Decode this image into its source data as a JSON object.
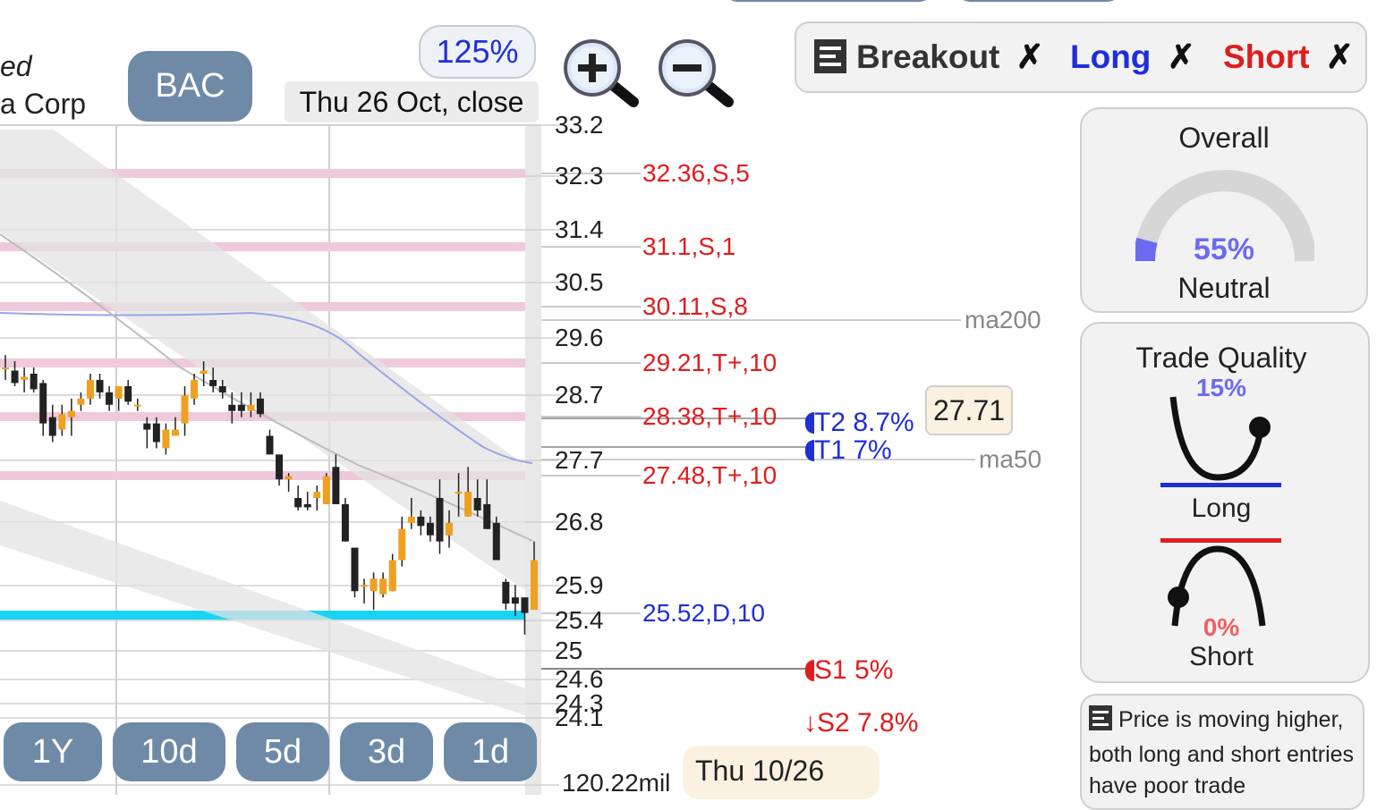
{
  "header": {
    "title_partial_1": "ed",
    "title_partial_2": "a Corp",
    "symbol": "BAC",
    "zoom_level": "125%",
    "date_label": "Thu 26 Oct, close"
  },
  "toggles": {
    "breakout": "Breakout",
    "long": "Long",
    "short": "Short",
    "off_mark": "✗"
  },
  "colors": {
    "long": "#1f2fd8",
    "short": "#e01d1d",
    "resistance_band": "#efc9dc",
    "support_line": "#19d3f5",
    "bullish_candle": "#f0a020",
    "bearish_candle": "#222222",
    "button": "#6f8aa6"
  },
  "price_axis": [
    "33.2",
    "32.3",
    "31.4",
    "30.5",
    "29.6",
    "28.7",
    "27.7",
    "26.8",
    "25.9",
    "25.4",
    "25",
    "24.6",
    "24.3",
    "24.1"
  ],
  "levels": [
    {
      "label": "32.36,S,5",
      "color": "red"
    },
    {
      "label": "31.1,S,1",
      "color": "red"
    },
    {
      "label": "30.11,S,8",
      "color": "red"
    },
    {
      "label": "29.21,T+,10",
      "color": "red"
    },
    {
      "label": "28.38,T+,10",
      "color": "red"
    },
    {
      "label": "27.48,T+,10",
      "color": "red"
    },
    {
      "label": "25.52,D,10",
      "color": "blue"
    }
  ],
  "moving_averages": {
    "ma200": "ma200",
    "ma50": "ma50"
  },
  "current_price": "27.71",
  "targets": {
    "t2": "T2 8.7%",
    "t1": "T1 7%",
    "s1": "S1 5%",
    "s2": "S2 7.8%"
  },
  "volume_label": "120.22mil",
  "cursor_date": "Thu 10/26",
  "timeframes": [
    "1Y",
    "10d",
    "5d",
    "3d",
    "1d"
  ],
  "overall": {
    "title": "Overall",
    "percent": "55%",
    "verdict": "Neutral",
    "value": 0.55
  },
  "trade_quality": {
    "title": "Trade Quality",
    "long_percent": "15%",
    "long_label": "Long",
    "short_percent": "0%",
    "short_label": "Short"
  },
  "note": {
    "text": "Price is moving higher, both long and short entries have poor trade"
  },
  "chart_data": {
    "type": "candlestick",
    "candles": [
      {
        "o": 29.3,
        "h": 29.5,
        "l": 29.1,
        "c": 29.3
      },
      {
        "o": 29.25,
        "h": 29.4,
        "l": 29.0,
        "c": 29.05
      },
      {
        "o": 29.1,
        "h": 29.3,
        "l": 28.9,
        "c": 29.15
      },
      {
        "o": 29.2,
        "h": 29.3,
        "l": 28.9,
        "c": 28.95
      },
      {
        "o": 29.05,
        "h": 29.1,
        "l": 28.2,
        "c": 28.4
      },
      {
        "o": 28.5,
        "h": 28.7,
        "l": 28.1,
        "c": 28.2
      },
      {
        "o": 28.3,
        "h": 28.7,
        "l": 28.2,
        "c": 28.55
      },
      {
        "o": 28.5,
        "h": 28.8,
        "l": 28.2,
        "c": 28.6
      },
      {
        "o": 28.7,
        "h": 28.9,
        "l": 28.6,
        "c": 28.8
      },
      {
        "o": 28.8,
        "h": 29.2,
        "l": 28.7,
        "c": 29.1
      },
      {
        "o": 29.1,
        "h": 29.2,
        "l": 28.8,
        "c": 28.9
      },
      {
        "o": 28.9,
        "h": 29.0,
        "l": 28.6,
        "c": 28.7
      },
      {
        "o": 28.8,
        "h": 29.0,
        "l": 28.6,
        "c": 29.0
      },
      {
        "o": 29.0,
        "h": 29.1,
        "l": 28.7,
        "c": 28.75
      },
      {
        "o": 28.7,
        "h": 28.8,
        "l": 28.6,
        "c": 28.7
      },
      {
        "o": 28.4,
        "h": 28.5,
        "l": 28.0,
        "c": 28.3
      },
      {
        "o": 28.4,
        "h": 28.5,
        "l": 28.0,
        "c": 28.1
      },
      {
        "o": 28.0,
        "h": 28.4,
        "l": 27.9,
        "c": 28.3
      },
      {
        "o": 28.2,
        "h": 28.5,
        "l": 28.2,
        "c": 28.3
      },
      {
        "o": 28.4,
        "h": 29.0,
        "l": 28.2,
        "c": 28.85
      },
      {
        "o": 28.8,
        "h": 29.2,
        "l": 28.7,
        "c": 29.1
      },
      {
        "o": 29.2,
        "h": 29.4,
        "l": 29.0,
        "c": 29.25
      },
      {
        "o": 29.1,
        "h": 29.3,
        "l": 28.9,
        "c": 29.0
      },
      {
        "o": 29.0,
        "h": 29.1,
        "l": 28.8,
        "c": 28.9
      },
      {
        "o": 28.7,
        "h": 28.9,
        "l": 28.4,
        "c": 28.6
      },
      {
        "o": 28.7,
        "h": 28.9,
        "l": 28.5,
        "c": 28.6
      },
      {
        "o": 28.6,
        "h": 28.9,
        "l": 28.5,
        "c": 28.7
      },
      {
        "o": 28.8,
        "h": 28.9,
        "l": 28.5,
        "c": 28.55
      },
      {
        "o": 28.2,
        "h": 28.3,
        "l": 27.9,
        "c": 27.9
      },
      {
        "o": 27.9,
        "h": 27.9,
        "l": 27.4,
        "c": 27.5
      },
      {
        "o": 27.5,
        "h": 27.6,
        "l": 27.3,
        "c": 27.55
      },
      {
        "o": 27.2,
        "h": 27.4,
        "l": 27.0,
        "c": 27.05
      },
      {
        "o": 27.1,
        "h": 27.3,
        "l": 27.0,
        "c": 27.05
      },
      {
        "o": 27.2,
        "h": 27.4,
        "l": 27.0,
        "c": 27.3
      },
      {
        "o": 27.1,
        "h": 27.6,
        "l": 27.1,
        "c": 27.55
      },
      {
        "o": 27.7,
        "h": 27.9,
        "l": 27.1,
        "c": 27.1
      },
      {
        "o": 27.1,
        "h": 27.2,
        "l": 26.5,
        "c": 26.5
      },
      {
        "o": 26.4,
        "h": 26.4,
        "l": 25.6,
        "c": 25.7
      },
      {
        "o": 25.8,
        "h": 25.9,
        "l": 25.5,
        "c": 25.8
      },
      {
        "o": 25.7,
        "h": 26.0,
        "l": 25.4,
        "c": 25.9
      },
      {
        "o": 25.65,
        "h": 26.0,
        "l": 25.6,
        "c": 25.9
      },
      {
        "o": 25.7,
        "h": 26.3,
        "l": 25.7,
        "c": 26.2
      },
      {
        "o": 26.2,
        "h": 26.9,
        "l": 26.1,
        "c": 26.7
      },
      {
        "o": 26.8,
        "h": 27.2,
        "l": 26.7,
        "c": 26.9
      },
      {
        "o": 26.9,
        "h": 27.0,
        "l": 26.6,
        "c": 26.75
      },
      {
        "o": 26.8,
        "h": 26.9,
        "l": 26.5,
        "c": 26.6
      },
      {
        "o": 27.2,
        "h": 27.5,
        "l": 26.3,
        "c": 26.5
      },
      {
        "o": 26.6,
        "h": 27.0,
        "l": 26.4,
        "c": 26.8
      },
      {
        "o": 27.3,
        "h": 27.6,
        "l": 26.9,
        "c": 27.3
      },
      {
        "o": 26.9,
        "h": 27.7,
        "l": 26.9,
        "c": 27.3
      },
      {
        "o": 27.2,
        "h": 27.5,
        "l": 26.9,
        "c": 27.0
      },
      {
        "o": 27.1,
        "h": 27.5,
        "l": 26.7,
        "c": 26.7
      },
      {
        "o": 26.8,
        "h": 26.9,
        "l": 26.2,
        "c": 26.2
      },
      {
        "o": 25.85,
        "h": 25.9,
        "l": 25.4,
        "c": 25.5
      },
      {
        "o": 25.6,
        "h": 25.8,
        "l": 25.3,
        "c": 25.5
      },
      {
        "o": 25.6,
        "h": 25.6,
        "l": 25.0,
        "c": 25.35
      },
      {
        "o": 25.4,
        "h": 26.5,
        "l": 25.4,
        "c": 26.2
      }
    ],
    "resistance_bands": [
      32.36,
      31.1,
      30.11,
      29.21,
      28.38,
      27.48
    ],
    "support_line": 25.52
  }
}
